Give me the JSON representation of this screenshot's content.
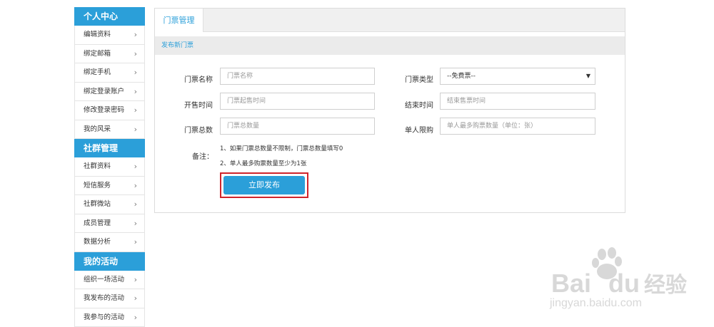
{
  "sidebar": {
    "groups": [
      {
        "title": "个人中心",
        "items": [
          "编辑资料",
          "绑定邮箱",
          "绑定手机",
          "绑定登录账户",
          "修改登录密码",
          "我的风采"
        ]
      },
      {
        "title": "社群管理",
        "items": [
          "社群资料",
          "短信服务",
          "社群微站",
          "成员管理",
          "数据分析"
        ]
      },
      {
        "title": "我的活动",
        "items": [
          "组织一场活动",
          "我发布的活动",
          "我参与的活动"
        ]
      }
    ],
    "chevron": "›"
  },
  "main": {
    "tab": "门票管理",
    "section_title": "发布新门票",
    "form": {
      "ticket_name_label": "门票名称",
      "ticket_name_placeholder": "门票名称",
      "ticket_type_label": "门票类型",
      "ticket_type_value": "--免费票--",
      "sale_start_label": "开售时间",
      "sale_start_placeholder": "门票起售时间",
      "sale_end_label": "结束时间",
      "sale_end_placeholder": "结束售票时间",
      "total_label": "门票总数",
      "total_placeholder": "门票总数量",
      "limit_label": "单人限购",
      "limit_placeholder": "单人最多购票数量（单位：张）",
      "note_label": "备注：",
      "note_1": "1、如果门票总数量不限制，门票总数量填写0",
      "note_2": "2、单人最多购票数量至少为1张",
      "submit": "立即发布"
    }
  },
  "watermark": {
    "brand": "Bai",
    "brand2": "du",
    "cn": "经验",
    "url": "jingyan.baidu.com"
  }
}
